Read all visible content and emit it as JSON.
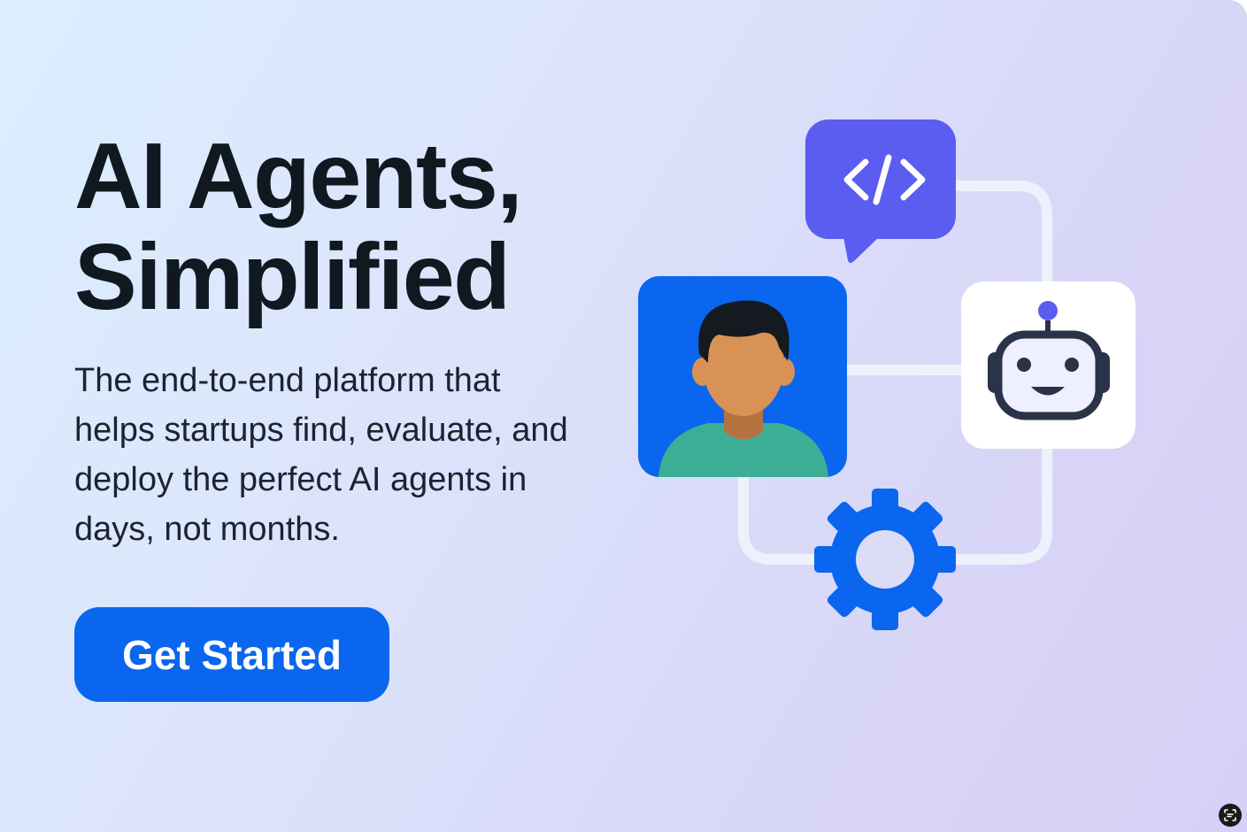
{
  "hero": {
    "headline_line1": "AI Agents,",
    "headline_line2": "Simplified",
    "subtext": "The end-to-end platform that helps startups find, evaluate, and deploy the perfect AI agents in days, not months.",
    "cta_label": "Get Started"
  },
  "illustration": {
    "icons": [
      "code-chat-icon",
      "person-avatar-icon",
      "robot-icon",
      "gear-icon"
    ]
  },
  "colors": {
    "accent": "#0a66ef",
    "code_bubble": "#5b5cf0",
    "headline": "#101820",
    "robot_outline": "#2a3347",
    "robot_antenna": "#5b5cf0"
  }
}
